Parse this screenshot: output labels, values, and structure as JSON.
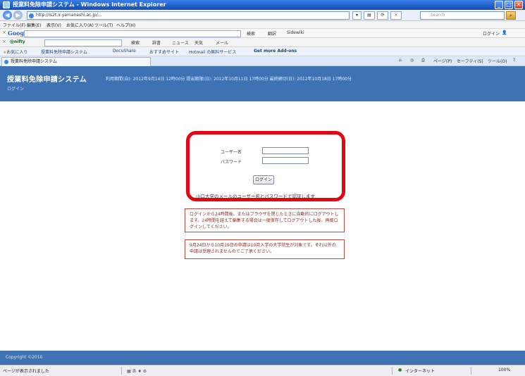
{
  "window": {
    "title": "授業料免除申請システム - Windows Internet Explorer"
  },
  "address_bar": {
    "url": "http://is2t.ir.yamanashi.ac.jp/...",
    "search_placeholder": "Search"
  },
  "menu": [
    "ファイル(F)",
    "編集(E)",
    "表示(V)",
    "お気に入り(A)",
    "ツール(T)",
    "ヘルプ(H)"
  ],
  "google_toolbar": {
    "logo": "Google",
    "items": [
      "検索",
      "翻訳",
      "Sidewiki",
      "ログイン"
    ]
  },
  "second_toolbar": {
    "logo": "@nifty",
    "items": [
      "検索",
      "辞書",
      "ニュース",
      "天気",
      "メール"
    ]
  },
  "favorites": {
    "label": "お気に入り",
    "items": [
      "授業料免除申請システム",
      "DocuShare",
      "おすすめサイト",
      "Hotmail の無料サービス",
      "Get more Add-ons"
    ]
  },
  "tab": {
    "title": "授業料免除申請システム",
    "commands": [
      "ページ(P)",
      "セーフティ(S)",
      "ツール(O)"
    ]
  },
  "page": {
    "system_title": "授業料免除申請システム",
    "periods": "利用期間(自): 2012年9月14日 12時00分    提出期限(日): 2012年10月11日 17時00分    最終締切(日): 2012年10月18日 17時00分",
    "login_link": "ログイン"
  },
  "form": {
    "username_label": "ユーザー名",
    "password_label": "パスワード",
    "login_button": "ログイン",
    "hint": "山口大学のメールのユーザー名とパスワードで認証します"
  },
  "notices": [
    "ログインから24時間後、またはブラウザを閉じたときに自動的にログアウトします。24時間を越えて編集する場合は一度保存してログアウトした後、再度ログインしてください。",
    "9月24日から10月19日の申請は10月入学の大学院生が対象です。それ以外の申請は受理されませんのでご了承ください。"
  ],
  "footer": {
    "copyright": "Copyright ©2010"
  },
  "status_bar": {
    "message": "ページが表示されました",
    "zone": "インターネット",
    "zoom": "100%"
  }
}
